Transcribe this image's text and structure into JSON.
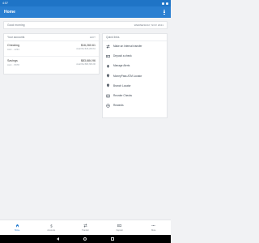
{
  "status_bar": {
    "time": "4:57"
  },
  "app_bar": {
    "title": "Home"
  },
  "banner": {
    "left": "Good morning",
    "right": "WEDNESDAY, NOV 2021"
  },
  "accounts": {
    "title": "Your accounts",
    "edit": "EDIT",
    "items": [
      {
        "name": "Checking",
        "number": "Acct ...1234",
        "balance": "$16,260.61",
        "sub": "Avail Bal $16,260.61"
      },
      {
        "name": "Savings",
        "number": "Acct ...5678",
        "balance": "$83,684.96",
        "sub": "Avail Bal $83,684.96"
      }
    ]
  },
  "quick_links": {
    "title": "Quick links",
    "items": [
      {
        "label": "Make an Internal transfer",
        "icon": "transfer-icon"
      },
      {
        "label": "Deposit a check",
        "icon": "deposit-icon"
      },
      {
        "label": "Manage Alerts",
        "icon": "bell-icon"
      },
      {
        "label": "MoneyPass ATM Locator",
        "icon": "location-icon"
      },
      {
        "label": "Branch Locator",
        "icon": "location-icon"
      },
      {
        "label": "Reorder Checks",
        "icon": "checkbook-icon"
      },
      {
        "label": "Rewards",
        "icon": "star-icon"
      }
    ]
  },
  "bottom_nav": {
    "items": [
      {
        "label": "Home",
        "icon": "home-icon",
        "active": true
      },
      {
        "label": "Accounts",
        "icon": "dollar-icon",
        "active": false
      },
      {
        "label": "Transfer",
        "icon": "transfer-icon",
        "active": false
      },
      {
        "label": "Deposit",
        "icon": "deposit-icon",
        "active": false
      },
      {
        "label": "More",
        "icon": "more-icon",
        "active": false
      }
    ]
  },
  "colors": {
    "primary": "#2a7fd1",
    "status_bar": "#1f74c6",
    "background": "#f1f2f4"
  }
}
